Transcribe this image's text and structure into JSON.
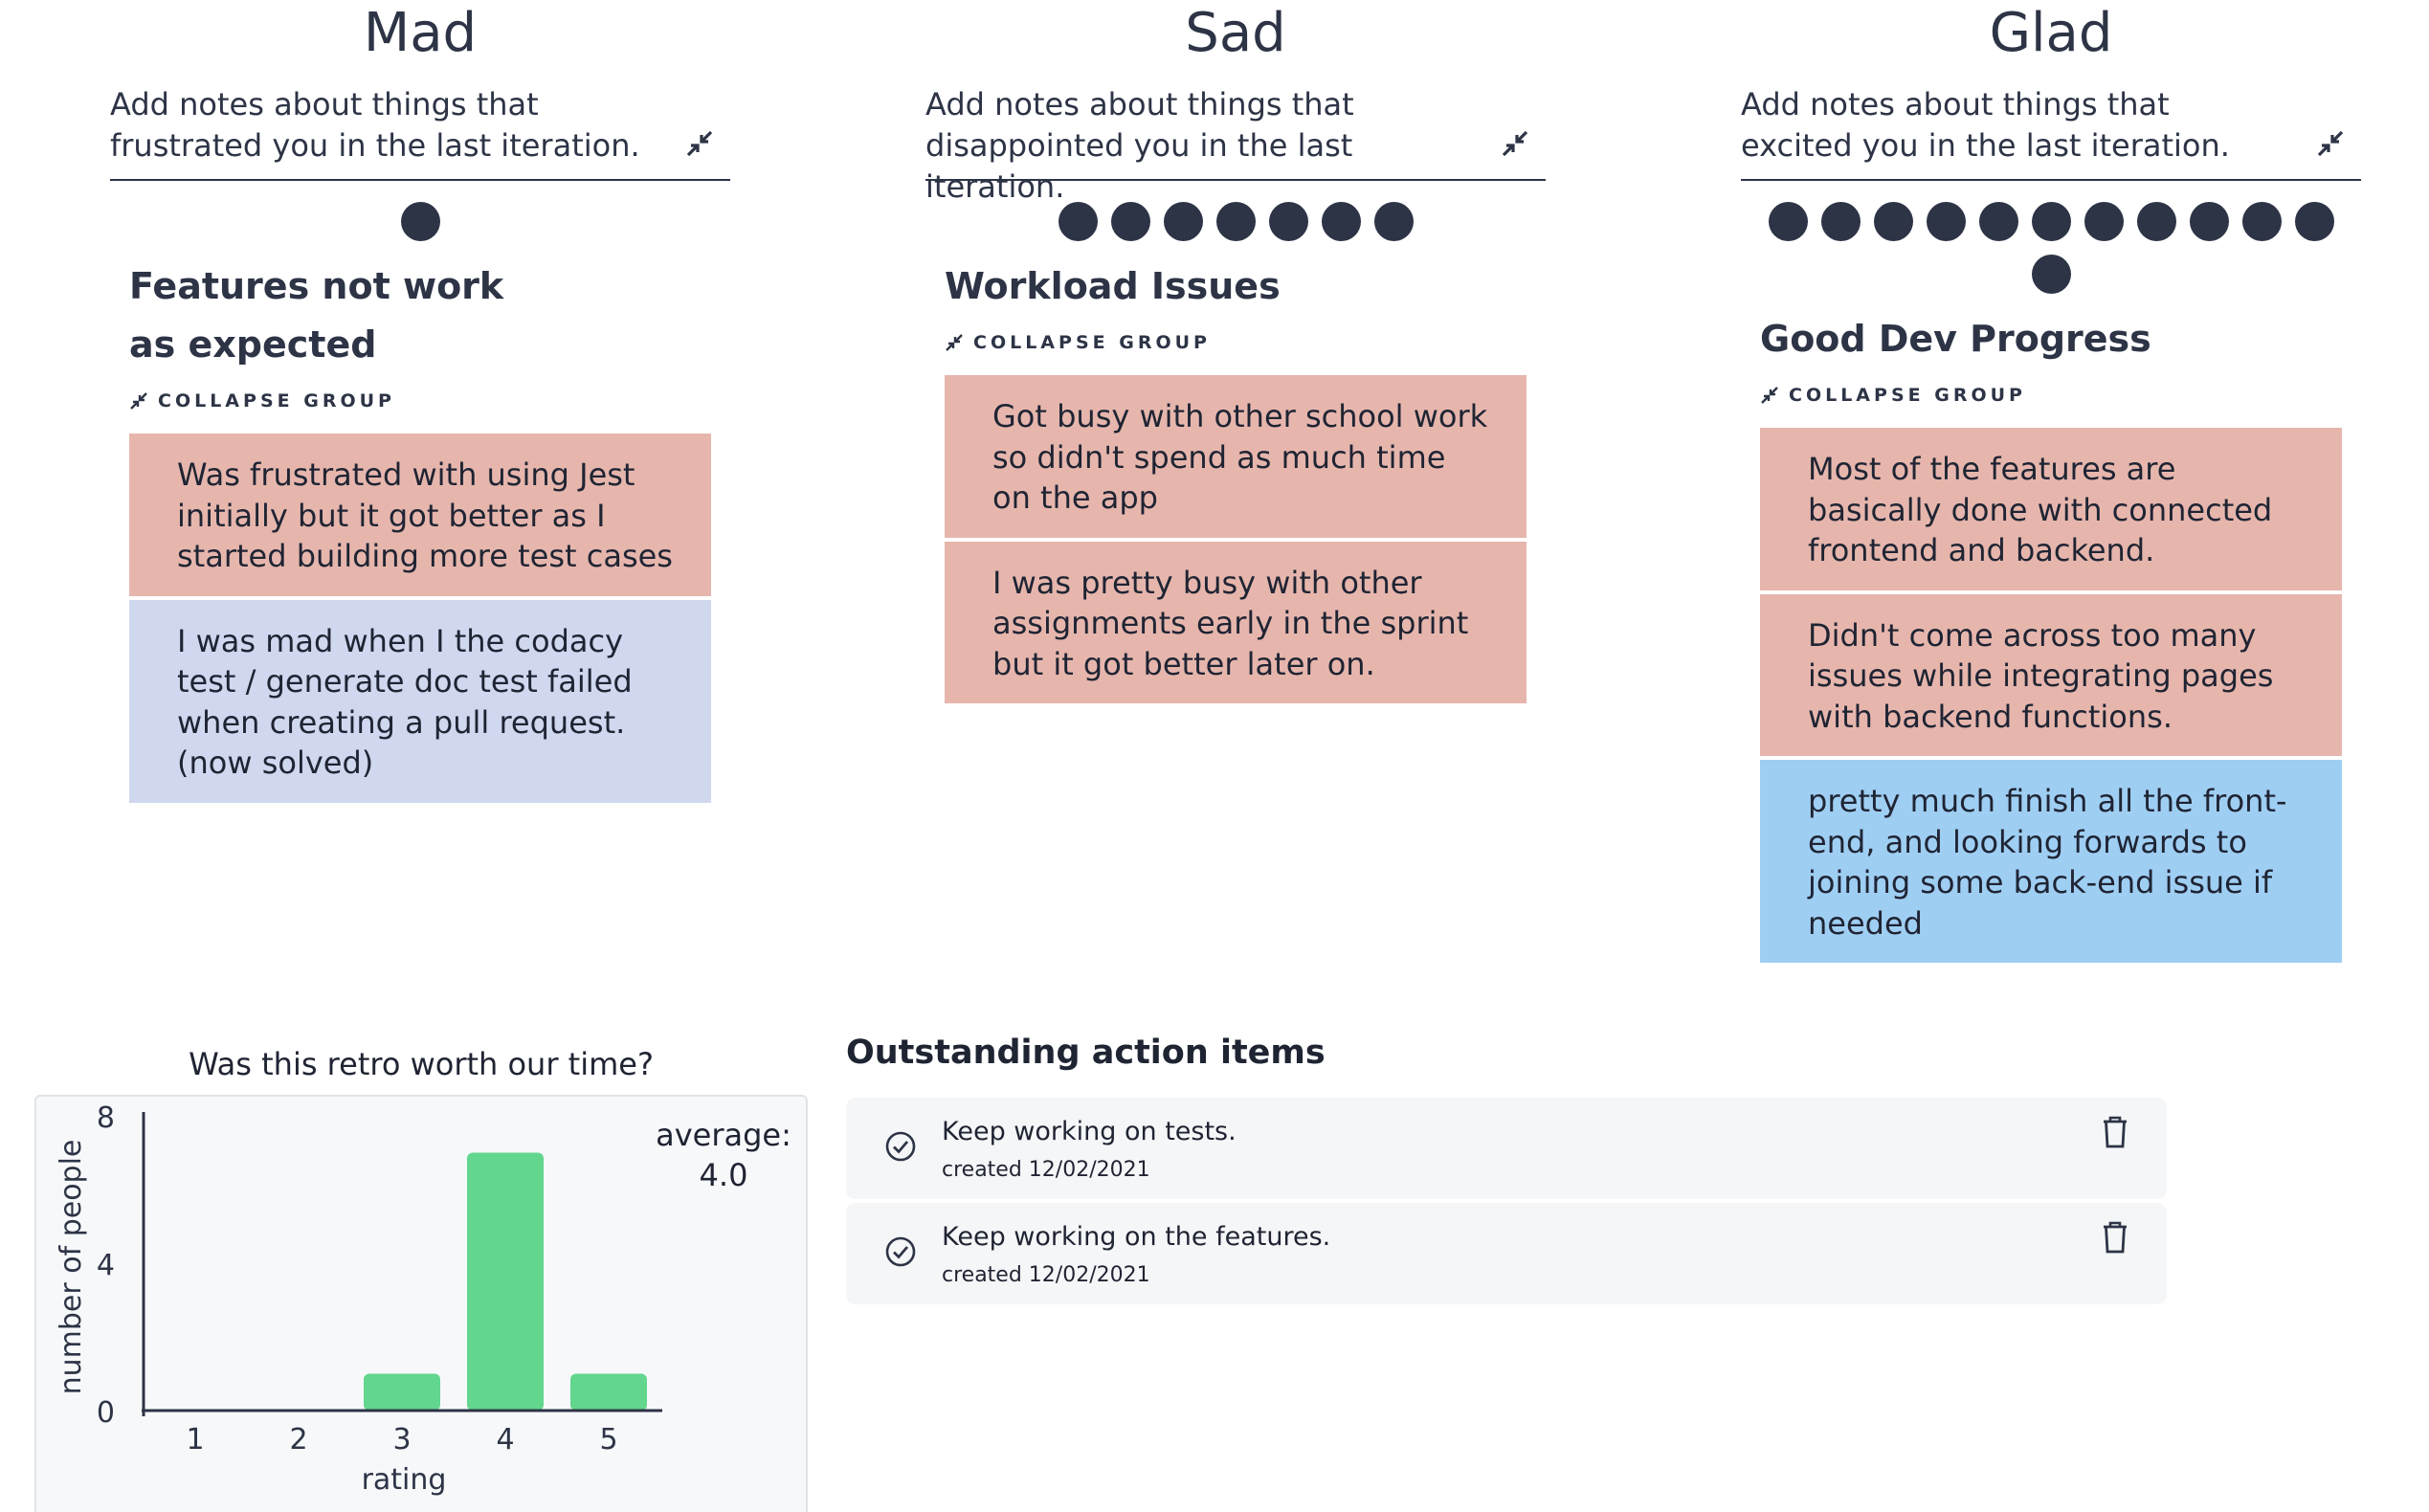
{
  "columns": [
    {
      "title": "Mad",
      "description": "Add notes about things that frustrated you in the last iteration.",
      "vote_count": 1,
      "group": {
        "title": "Features not work as expected",
        "collapse_label": "COLLAPSE GROUP",
        "cards": [
          {
            "text": "Was frustrated with using Jest initially but it got better as I started building more test cases",
            "color": "#e6b6ad"
          },
          {
            "text": "I was mad when I the codacy test / generate doc test failed when creating a pull request. (now solved)",
            "color": "#cfd8ef"
          }
        ]
      }
    },
    {
      "title": "Sad",
      "description": "Add notes about things that disappointed you in the last iteration.",
      "vote_count": 7,
      "group": {
        "title": "Workload Issues",
        "collapse_label": "COLLAPSE GROUP",
        "cards": [
          {
            "text": "Got busy with other school work so didn't spend as much time on the app",
            "color": "#e6b6ad"
          },
          {
            "text": "I was pretty busy with other assignments early in the sprint but it got better later on.",
            "color": "#e6b6ad"
          }
        ]
      }
    },
    {
      "title": "Glad",
      "description": "Add notes about things that excited you in the last iteration.",
      "vote_count": 12,
      "group": {
        "title": "Good Dev Progress",
        "collapse_label": "COLLAPSE GROUP",
        "cards": [
          {
            "text": "Most of the features are basically done with connected frontend and backend.",
            "color": "#e6b6ad"
          },
          {
            "text": "Didn't come across too many issues while integrating pages with backend functions.",
            "color": "#e6b6ad"
          },
          {
            "text": "pretty much finish all the front-end, and looking forwards to joining some back-end issue if needed",
            "color": "#9fcef3"
          }
        ]
      }
    }
  ],
  "retro_worth": {
    "title": "Was this retro worth our time?",
    "average_label": "average:",
    "average_value": "4.0"
  },
  "chart_data": {
    "type": "bar",
    "categories": [
      "1",
      "2",
      "3",
      "4",
      "5"
    ],
    "values": [
      0,
      0,
      1,
      7,
      1
    ],
    "xlabel": "rating",
    "ylabel": "number of people",
    "ylim": [
      0,
      8
    ],
    "yticks": [
      "0",
      "4",
      "8"
    ],
    "bar_color": "#62d68d",
    "grid": false
  },
  "action_items": {
    "title": "Outstanding action items",
    "items": [
      {
        "text": "Keep working on tests.",
        "created": "created 12/02/2021"
      },
      {
        "text": "Keep working on the features.",
        "created": "created 12/02/2021"
      }
    ]
  },
  "icons": {
    "collapse": "collapse-arrows-icon",
    "check": "check-circle-icon",
    "trash": "trash-icon"
  }
}
